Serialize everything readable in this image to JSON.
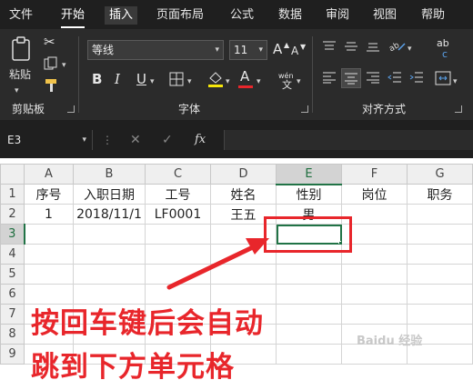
{
  "menu": {
    "tabs": [
      "文件",
      "开始",
      "插入",
      "页面布局",
      "公式",
      "数据",
      "审阅",
      "视图",
      "帮助"
    ],
    "active_index": 1,
    "highlight_index": 2
  },
  "ribbon": {
    "clipboard": {
      "paste_label": "粘贴",
      "group_label": "剪贴板"
    },
    "font": {
      "font_name": "等线",
      "font_size": "11",
      "group_label": "字体",
      "bold": "B",
      "italic": "I",
      "underline": "U",
      "fontcolor": "A",
      "grow": "A",
      "shrink": "A",
      "wen": "wén",
      "wen2": "文"
    },
    "alignment": {
      "group_label": "对齐方式",
      "wrap": "ab",
      "wrap2": "c"
    }
  },
  "formula_bar": {
    "name_box": "E3",
    "fx": "fx"
  },
  "sheet": {
    "columns": [
      "A",
      "B",
      "C",
      "D",
      "E",
      "F",
      "G"
    ],
    "rows": [
      {
        "num": "1",
        "cells": [
          "序号",
          "入职日期",
          "工号",
          "姓名",
          "性别",
          "岗位",
          "职务"
        ]
      },
      {
        "num": "2",
        "cells": [
          "1",
          "2018/11/1",
          "LF0001",
          "王五",
          "男",
          "",
          ""
        ]
      },
      {
        "num": "3",
        "cells": [
          "",
          "",
          "",
          "",
          "",
          "",
          ""
        ]
      },
      {
        "num": "4",
        "cells": [
          "",
          "",
          "",
          "",
          "",
          "",
          ""
        ]
      },
      {
        "num": "5",
        "cells": [
          "",
          "",
          "",
          "",
          "",
          "",
          ""
        ]
      },
      {
        "num": "6",
        "cells": [
          "",
          "",
          "",
          "",
          "",
          "",
          ""
        ]
      },
      {
        "num": "7",
        "cells": [
          "",
          "",
          "",
          "",
          "",
          "",
          ""
        ]
      },
      {
        "num": "8",
        "cells": [
          "",
          "",
          "",
          "",
          "",
          "",
          ""
        ]
      },
      {
        "num": "9",
        "cells": [
          "",
          "",
          "",
          "",
          "",
          "",
          ""
        ]
      }
    ],
    "selected_column": "E",
    "selected_row": "3"
  },
  "annotation": {
    "line1": "按回车键后会自动",
    "line2": "跳到下方单元格",
    "color": "#e8262b"
  },
  "watermark": "Baidu 经验"
}
